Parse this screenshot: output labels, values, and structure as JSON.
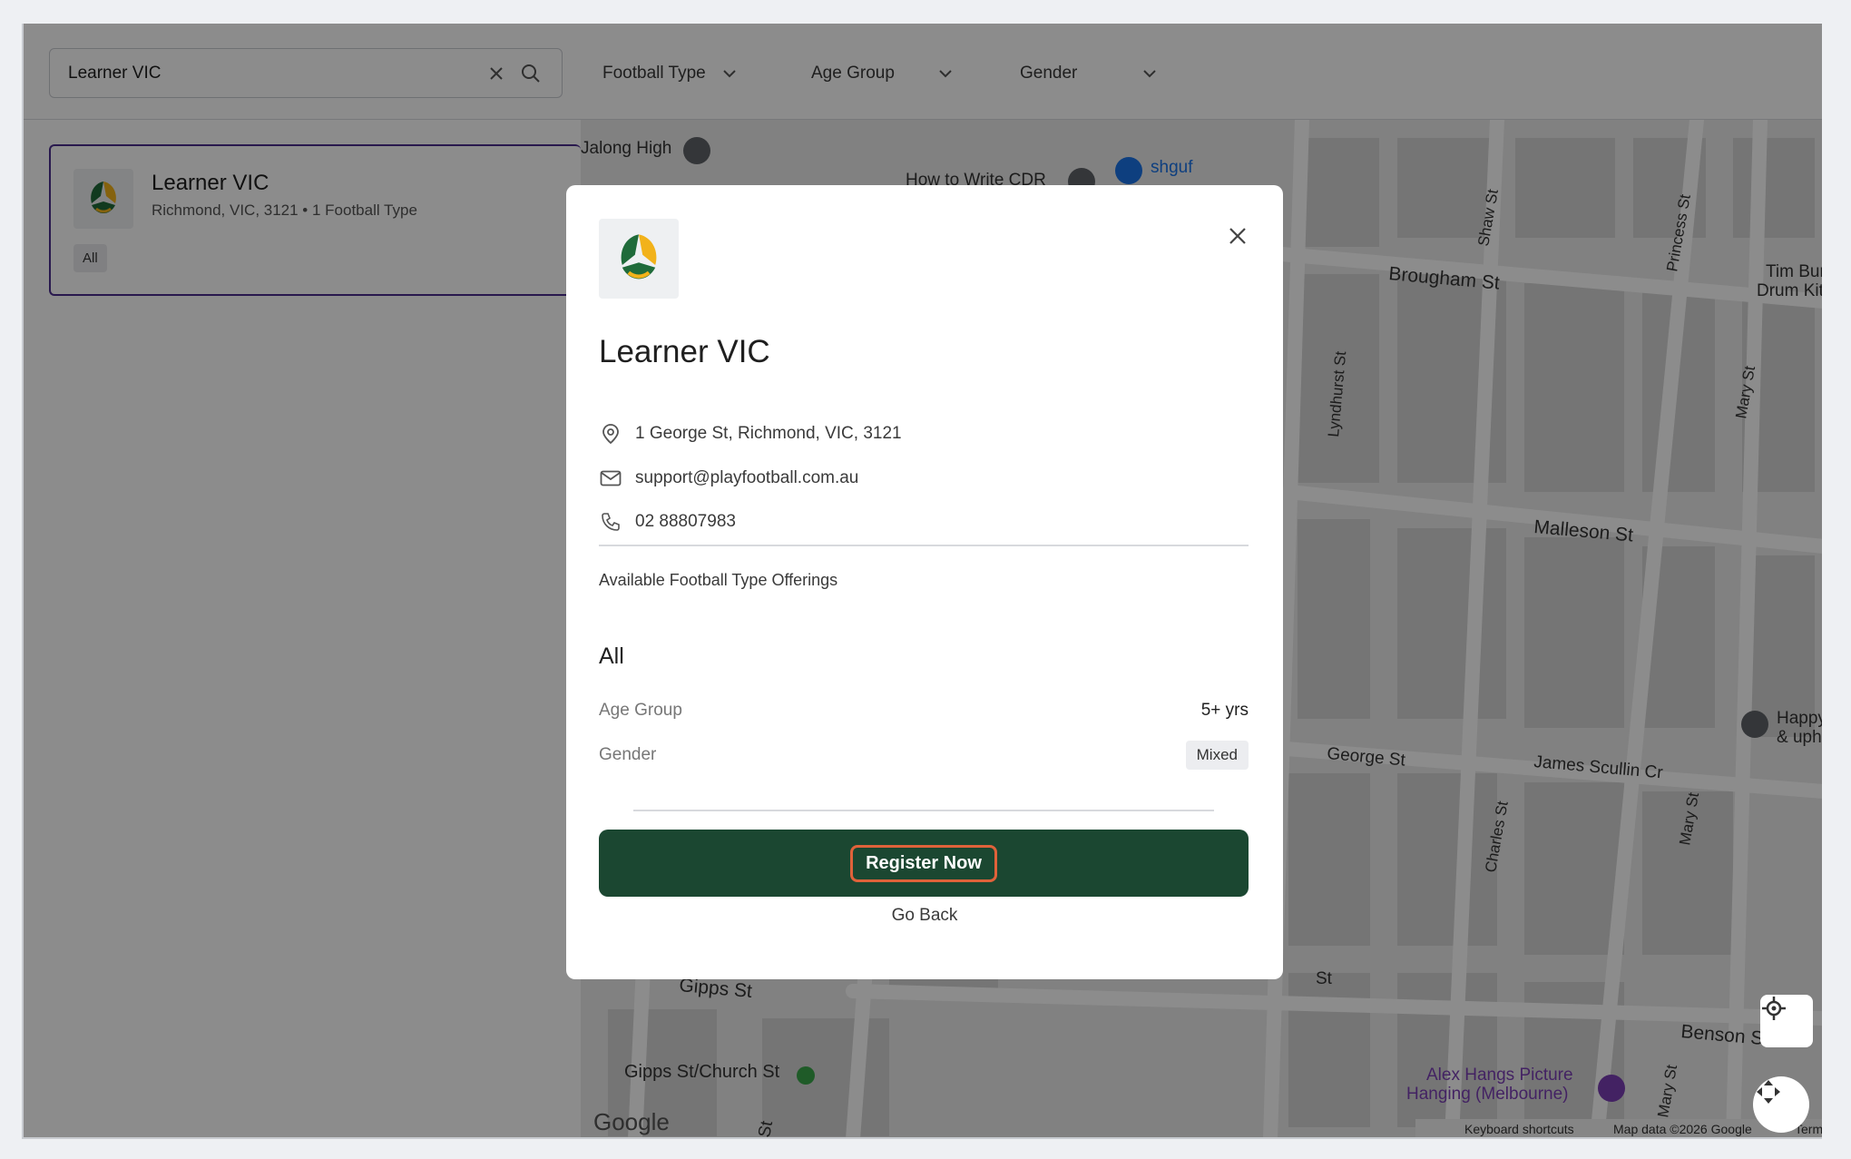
{
  "search": {
    "value": "Learner VIC"
  },
  "filters": [
    {
      "label": "Football Type"
    },
    {
      "label": "Age Group"
    },
    {
      "label": "Gender"
    }
  ],
  "result_card": {
    "title": "Learner VIC",
    "subtitle": "Richmond, VIC, 3121 • 1 Football Type",
    "tag": "All"
  },
  "map": {
    "labels": {
      "jalong": "Jalong High",
      "howto": "How to Write CDR",
      "shguf": "shguf",
      "brougham": "Brougham St",
      "shaw": "Shaw St",
      "princess": "Princess St",
      "timburn": "Tim Burn",
      "drumkit": "Drum Kit T",
      "lyndhurst": "Lyndhurst St",
      "mary_top": "Mary St",
      "malleson": "Malleson St",
      "george": "George St",
      "scullin": "James Scullin Cr",
      "charles": "Charles St",
      "mary_mid": "Mary St",
      "happy1": "Happyn",
      "happy2": "& uphol",
      "gipps": "Gipps St",
      "gipps_church": "Gipps St/Church St",
      "benson": "Benson St",
      "alex1": "Alex Hangs Picture",
      "alex2": "Hanging (Melbourne)",
      "mary_bot": "Mary St",
      "st_partial": "St",
      "st_partial2": "St",
      "google": "Google",
      "keyboard": "Keyboard shortcuts",
      "mapdata": "Map data ©2026 Google",
      "terms": "Terms"
    },
    "colors": {
      "park": "#3aa64a",
      "road": "#ffffff",
      "block": "#d6d6d6",
      "base": "#ececec"
    }
  },
  "modal": {
    "title": "Learner VIC",
    "address": "1 George St, Richmond, VIC, 3121",
    "email": "support@playfootball.com.au",
    "phone": "02 88807983",
    "section_title": "Available Football Type Offerings",
    "type_name": "All",
    "age_label": "Age Group",
    "age_value": "5+ yrs",
    "gender_label": "Gender",
    "gender_value": "Mixed",
    "register_label": "Register Now",
    "back_label": "Go Back"
  },
  "colors": {
    "primary": "#1b4731",
    "accent_outline": "#e0623a",
    "card_border": "#4b2f8f"
  }
}
